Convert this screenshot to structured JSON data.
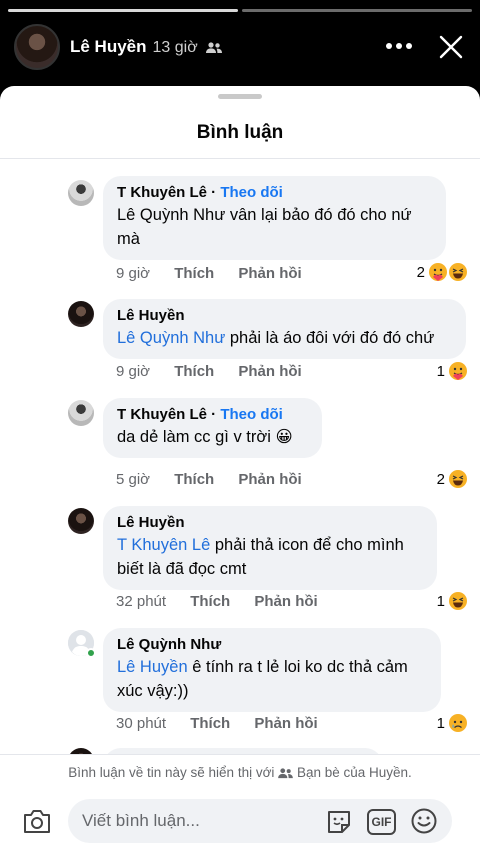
{
  "story": {
    "author": "Lê Huyền",
    "time": "13 giờ",
    "audience_icon": "friends-icon"
  },
  "sheet": {
    "title": "Bình luận"
  },
  "comments": [
    {
      "name": "T Khuyên Lê",
      "separator": " · ",
      "follow": "Theo dõi",
      "text_line1": "Lê Quỳnh Như vân  lại bảo đó đó cho nứ",
      "text_line2": "mà",
      "time": "9 giờ",
      "like": "Thích",
      "reply": "Phản hồi",
      "reaction_count": "2",
      "reactions": [
        "care-emoji",
        "haha-emoji"
      ]
    },
    {
      "name": "Lê Huyền",
      "mention": "Lê Quỳnh Như",
      "text": " phải là áo đôi với đó đó chứ",
      "time": "9 giờ",
      "like": "Thích",
      "reply": "Phản hồi",
      "reaction_count": "1",
      "reactions": [
        "care-emoji"
      ]
    },
    {
      "name": "T Khuyên Lê",
      "separator": " · ",
      "follow": "Theo dõi",
      "text": "da dẻ làm cc gì v trời 😀",
      "time": "5 giờ",
      "like": "Thích",
      "reply": "Phản hồi",
      "reaction_count": "2",
      "reactions": [
        "haha-emoji"
      ]
    },
    {
      "name": "Lê Huyền",
      "mention": "T Khuyên Lê",
      "text_line1": " phải thả icon để cho mình",
      "text_line2": "biết là đã đọc cmt",
      "time": "32 phút",
      "like": "Thích",
      "reply": "Phản hồi",
      "reaction_count": "1",
      "reactions": [
        "haha-emoji"
      ]
    },
    {
      "name": "Lê Quỳnh Như",
      "mention": "Lê Huyền",
      "text_line1": " ê tính ra t lẻ loi ko dc thả cảm",
      "text_line2": "xúc vậy:))",
      "time": "30 phút",
      "like": "Thích",
      "reply": "Phản hồi",
      "reaction_count": "1",
      "reactions": [
        "sad-emoji"
      ]
    }
  ],
  "footer": {
    "notice_before": "Bình luận về tin này sẽ hiển thị với ",
    "notice_after": " Bạn bè của Huyền.",
    "placeholder": "Viết bình luận...",
    "gif_label": "GIF"
  },
  "colors": {
    "link": "#1877f2",
    "mention": "#216fdb",
    "bubble": "#f0f2f5",
    "meta": "#65676b",
    "online": "#31a24c"
  }
}
